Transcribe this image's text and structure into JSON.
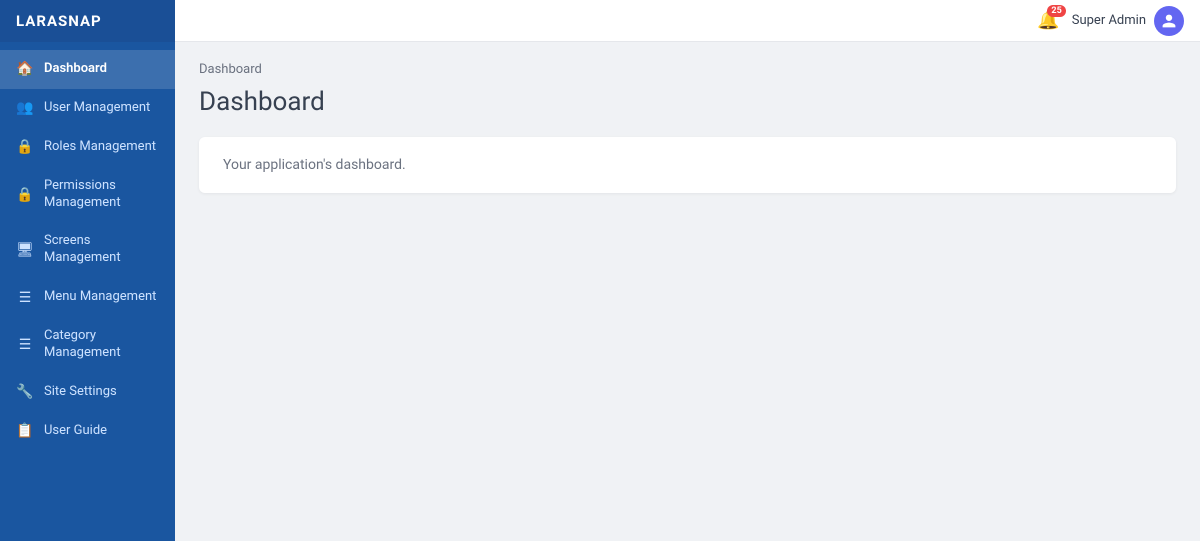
{
  "brand": {
    "name": "LARASNAP"
  },
  "topbar": {
    "notification_count": "25",
    "user_name": "Super Admin",
    "avatar_icon": "👤"
  },
  "breadcrumb": {
    "label": "Dashboard"
  },
  "page": {
    "title": "Dashboard",
    "card_text": "Your application's dashboard."
  },
  "sidebar": {
    "items": [
      {
        "id": "dashboard",
        "label": "Dashboard",
        "icon": "🏠",
        "active": true
      },
      {
        "id": "user-management",
        "label": "User Management",
        "icon": "👥",
        "active": false
      },
      {
        "id": "roles-management",
        "label": "Roles Management",
        "icon": "🔒",
        "active": false
      },
      {
        "id": "permissions-management",
        "label": "Permissions Management",
        "icon": "🔒",
        "active": false
      },
      {
        "id": "screens-management",
        "label": "Screens Management",
        "icon": "🖥",
        "active": false
      },
      {
        "id": "menu-management",
        "label": "Menu Management",
        "icon": "☰",
        "active": false
      },
      {
        "id": "category-management",
        "label": "Category Management",
        "icon": "☰",
        "active": false
      },
      {
        "id": "site-settings",
        "label": "Site Settings",
        "icon": "🔧",
        "active": false
      },
      {
        "id": "user-guide",
        "label": "User Guide",
        "icon": "📋",
        "active": false
      }
    ]
  }
}
